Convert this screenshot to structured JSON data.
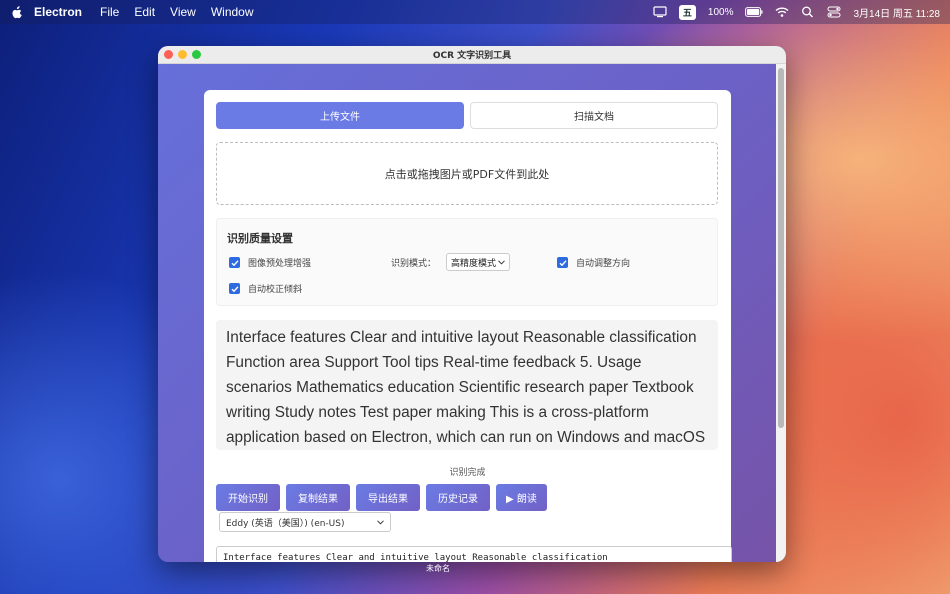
{
  "menubar": {
    "app_name": "Electron",
    "menus": [
      "File",
      "Edit",
      "View",
      "Window"
    ],
    "input_badge": "五",
    "battery": "100%",
    "datetime": "3月14日 周五  11:28"
  },
  "window": {
    "title": "OCR 文字识别工具"
  },
  "tabs": {
    "upload": "上传文件",
    "scan": "扫描文档"
  },
  "dropzone": {
    "text": "点击或拖拽图片或PDF文件到此处"
  },
  "settings": {
    "title": "识别质量设置",
    "preprocess_label": "图像预处理增强",
    "mode_label": "识别模式：",
    "mode_value": "高精度模式",
    "auto_rotate_label": "自动调整方向",
    "deskew_label": "自动校正倾斜"
  },
  "result": {
    "text": "Interface features Clear and intuitive layout Reasonable classification Function area Support Tool tips Real-time feedback 5. Usage scenarios Mathematics education Scientific research paper Textbook writing Study notes Test paper making This is a cross-platform application based on Electron, which can run on Windows and macOS systems."
  },
  "status": {
    "text": "识别完成"
  },
  "actions": {
    "start": "开始识别",
    "copy": "复制结果",
    "export": "导出结果",
    "history": "历史记录",
    "read": "▶ 朗读"
  },
  "voice": {
    "selected": "Eddy (英语（美国）) (en-US)"
  },
  "output": {
    "text": "Interface features Clear and intuitive layout Reasonable classification"
  },
  "caption": {
    "text": "未命名"
  }
}
